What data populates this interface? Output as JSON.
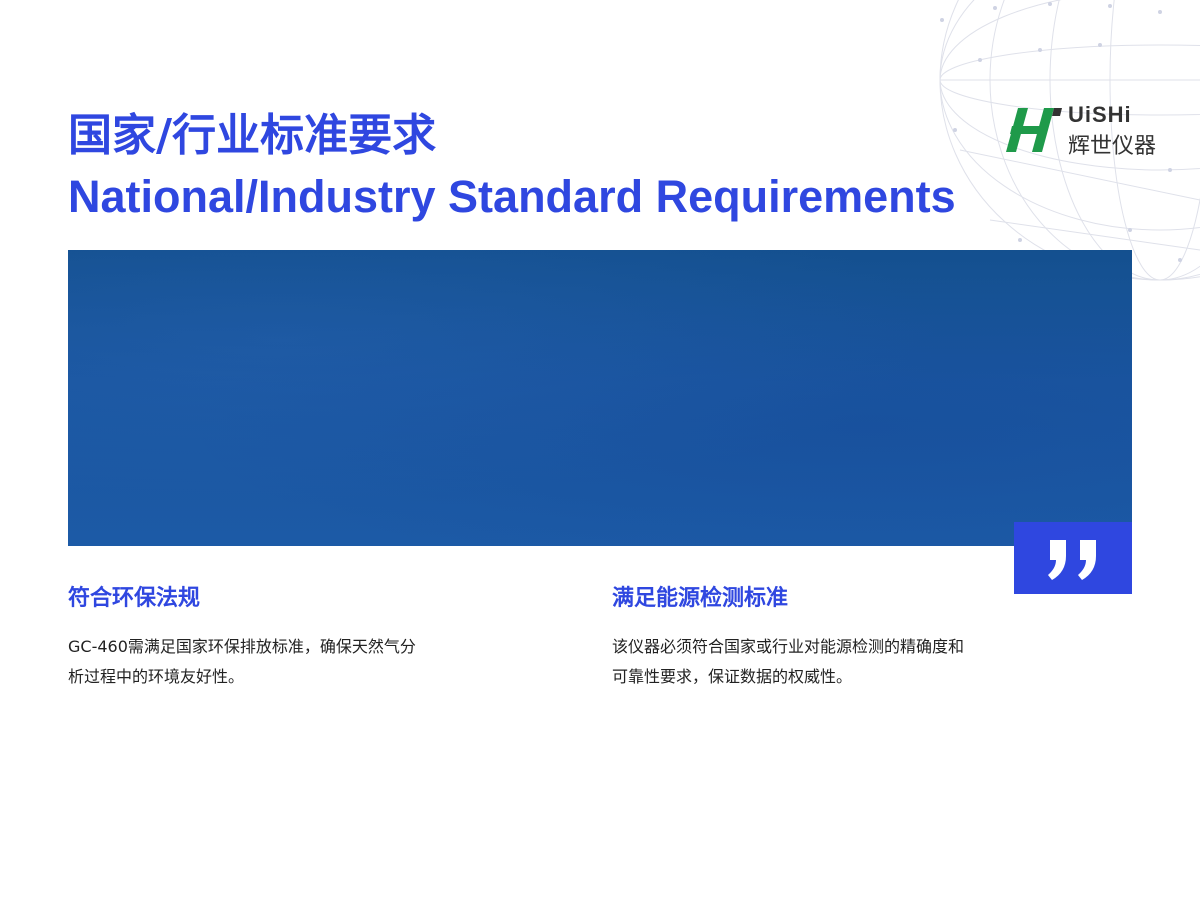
{
  "header": {
    "title_cn": "国家/行业标准要求",
    "title_en": "National/Industry Standard Requirements"
  },
  "logo": {
    "latin": "UiSHi",
    "cn": "辉世仪器",
    "mark_color": "#1f9a4a"
  },
  "banner": {
    "color": "#1a56a0"
  },
  "quote": {
    "icon": "quote-icon",
    "color": "#2f47e0"
  },
  "sections": [
    {
      "title": "符合环保法规",
      "body_line1": "GC-460需满足国家环保排放标准，确保天然气分",
      "body_line2": "析过程中的环境友好性。"
    },
    {
      "title": "满足能源检测标准",
      "body_line1": "该仪器必须符合国家或行业对能源检测的精确度和",
      "body_line2": "可靠性要求，保证数据的权威性。"
    }
  ],
  "colors": {
    "accent": "#2f47e0",
    "text": "#222222"
  }
}
